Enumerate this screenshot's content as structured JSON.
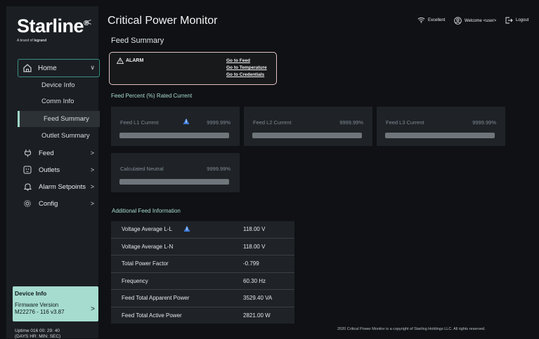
{
  "brand": {
    "logo": "Starline",
    "tagline": "A brand of",
    "tagline_brand": "legrand"
  },
  "header": {
    "app_title": "Critical Power Monitor",
    "page_title": "Feed Summary",
    "signal_label": "Excellent",
    "welcome_label": "Welcome <user>",
    "logout_label": "Logout"
  },
  "sidebar": {
    "home": {
      "label": "Home"
    },
    "home_items": [
      {
        "label": "Device Info"
      },
      {
        "label": "Comm Info"
      },
      {
        "label": "Feed Summary",
        "active": true
      },
      {
        "label": "Outlet Summary"
      }
    ],
    "nav_items": [
      {
        "label": "Feed",
        "icon": "plug-icon"
      },
      {
        "label": "Outlets",
        "icon": "outlet-icon"
      },
      {
        "label": "Alarm Setpoints",
        "icon": "bell-icon"
      },
      {
        "label": "Config",
        "icon": "gear-icon"
      }
    ],
    "device_card": {
      "title": "Device Info",
      "fw_label": "Firmware Version",
      "fw_value": "M22276 - 116 v3.87"
    },
    "uptime_line1": "Uptime 016 00: 29: 40",
    "uptime_line2": "(DAYS HR: MIN: SEC)"
  },
  "alarm": {
    "title": "ALARM",
    "links": [
      "Go to Feed",
      "Go to Temperature",
      "Go to Credentials"
    ]
  },
  "feed_section_label": "Feed Percent (%) Rated Current",
  "feeds": [
    {
      "label": "Feed L1 Current",
      "value": "9999.99%",
      "fill_pct": 100,
      "info": true
    },
    {
      "label": "Feed L2 Current",
      "value": "9999.99%",
      "fill_pct": 100,
      "info": false
    },
    {
      "label": "Feed L3 Current",
      "value": "9999.99%",
      "fill_pct": 100,
      "info": false
    },
    {
      "label": "Calculated Neutral",
      "value": "9999.99%",
      "fill_pct": 100,
      "info": false
    }
  ],
  "additional_label": "Additional Feed Information",
  "additional_rows": [
    {
      "key": "Voltage Average  L-L",
      "value": "118.00 V",
      "info": true
    },
    {
      "key": "Voltage Average L-N",
      "value": "118.00 V",
      "info": false
    },
    {
      "key": "Total Power Factor",
      "value": "-0.799",
      "info": false
    },
    {
      "key": "Frequency",
      "value": "60.30 Hz",
      "info": false
    },
    {
      "key": "Feed Total Apparent Power",
      "value": "3529.40 VA",
      "info": false
    },
    {
      "key": "Feed Total Active Power",
      "value": "2821.00 W",
      "info": false
    }
  ],
  "footer": "2020 Critical Power Monitor is a copyright of Starling Holdings LLC. All rights reserved.",
  "colors": {
    "accent": "#a6dccf",
    "alarm_border": "#e3c2c2",
    "info_badge": "#3b7bd8"
  }
}
